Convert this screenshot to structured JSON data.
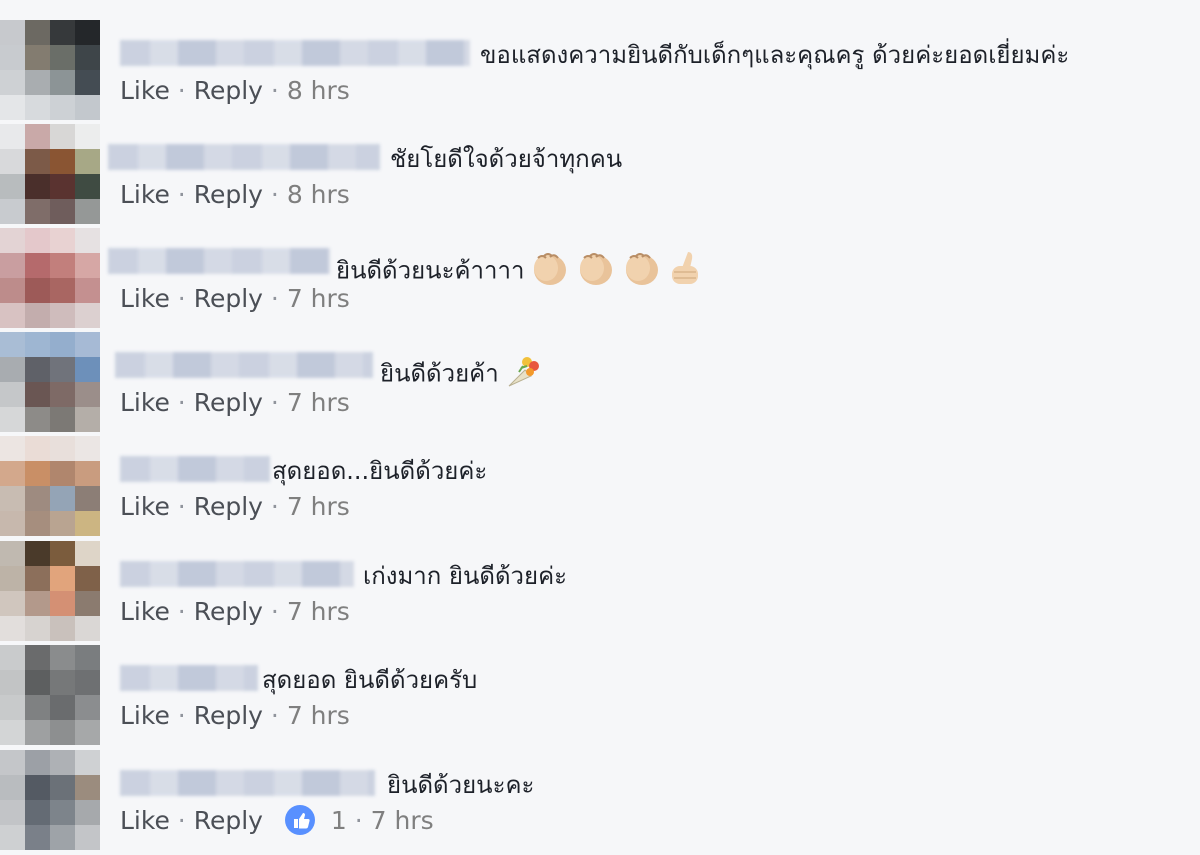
{
  "colors": {
    "background": "#f6f7f9",
    "link": "#4b4f56",
    "muted": "#90949c",
    "like_badge": "#5890ff"
  },
  "comments": [
    {
      "text": "ขอแสดงความยินดีกับเด็กๆและคุณครู ด้วยค่ะยอดเยี่ยมค่ะ",
      "like": "Like",
      "reply": "Reply",
      "time": "8 hrs"
    },
    {
      "text": "ชัยโยดีใจด้วยจ้าทุกคน",
      "like": "Like",
      "reply": "Reply",
      "time": "8 hrs"
    },
    {
      "text": "ยินดีด้วยนะค้าาาา",
      "emoji": [
        "clapping-hands",
        "clapping-hands",
        "clapping-hands",
        "thumbs-up"
      ],
      "like": "Like",
      "reply": "Reply",
      "time": "7 hrs"
    },
    {
      "text": "ยินดีด้วยค้า",
      "emoji": [
        "bouquet"
      ],
      "like": "Like",
      "reply": "Reply",
      "time": "7 hrs"
    },
    {
      "text": "สุดยอด...ยินดีด้วยค่ะ",
      "like": "Like",
      "reply": "Reply",
      "time": "7 hrs"
    },
    {
      "text": "เก่งมาก ยินดีด้วยค่ะ",
      "like": "Like",
      "reply": "Reply",
      "time": "7 hrs"
    },
    {
      "text": "สุดยอด ยินดีด้วยครับ",
      "like": "Like",
      "reply": "Reply",
      "time": "7 hrs"
    },
    {
      "text": "ยินดีด้วยนะคะ",
      "like": "Like",
      "reply": "Reply",
      "like_count": "1",
      "time": "7 hrs",
      "has_like_icon": true
    }
  ]
}
